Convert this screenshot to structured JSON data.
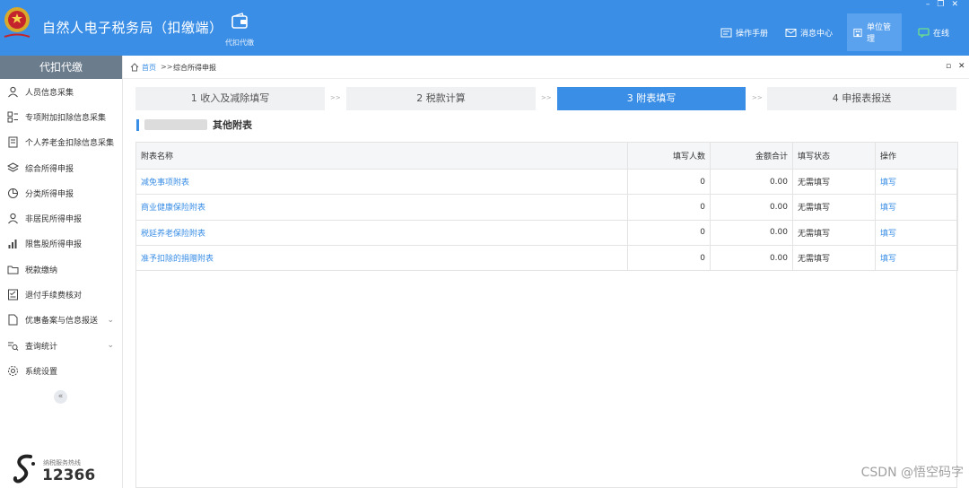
{
  "header": {
    "title": "自然人电子税务局（扣缴端）",
    "module_label": "代扣代缴",
    "menu": [
      {
        "label": "操作手册",
        "icon": "manual-icon"
      },
      {
        "label": "消息中心",
        "icon": "mail-icon"
      },
      {
        "label": "单位管理",
        "icon": "building-icon"
      },
      {
        "label": "在线",
        "icon": "chat-icon"
      }
    ],
    "window_controls": [
      "–",
      "❐",
      "✕"
    ]
  },
  "sidebar": {
    "title": "代扣代缴",
    "items": [
      {
        "label": "人员信息采集",
        "icon": "person-icon"
      },
      {
        "label": "专项附加扣除信息采集",
        "icon": "grid-icon"
      },
      {
        "label": "个人养老金扣除信息采集",
        "icon": "document-icon"
      },
      {
        "label": "综合所得申报",
        "icon": "layers-icon"
      },
      {
        "label": "分类所得申报",
        "icon": "pie-icon"
      },
      {
        "label": "非居民所得申报",
        "icon": "person-icon"
      },
      {
        "label": "限售股所得申报",
        "icon": "bar-chart-icon"
      },
      {
        "label": "税款缴纳",
        "icon": "folder-icon"
      },
      {
        "label": "退付手续费核对",
        "icon": "checklist-icon"
      },
      {
        "label": "优惠备案与信息报送",
        "icon": "file-icon",
        "expandable": true
      },
      {
        "label": "查询统计",
        "icon": "search-list-icon",
        "expandable": true
      },
      {
        "label": "系统设置",
        "icon": "gear-icon"
      }
    ],
    "collapse_glyph": "«",
    "hotline_label": "纳税服务热线",
    "hotline_number": "12366"
  },
  "breadcrumb": {
    "home": "首页",
    "separator": ">>",
    "current": "综合所得申报"
  },
  "steps": [
    {
      "label": "1 收入及减除填写",
      "active": false
    },
    {
      "label": "2 税款计算",
      "active": false
    },
    {
      "label": "3 附表填写",
      "active": true
    },
    {
      "label": "4 申报表报送",
      "active": false
    }
  ],
  "step_separator": ">>",
  "section": {
    "title": "其他附表"
  },
  "table": {
    "columns": [
      "附表名称",
      "填写人数",
      "金额合计",
      "填写状态",
      "操作"
    ],
    "rows": [
      {
        "name": "减免事项附表",
        "count": "0",
        "amount": "0.00",
        "status": "无需填写",
        "action": "填写"
      },
      {
        "name": "商业健康保险附表",
        "count": "0",
        "amount": "0.00",
        "status": "无需填写",
        "action": "填写"
      },
      {
        "name": "税延养老保险附表",
        "count": "0",
        "amount": "0.00",
        "status": "无需填写",
        "action": "填写"
      },
      {
        "name": "准予扣除的捐赠附表",
        "count": "0",
        "amount": "0.00",
        "status": "无需填写",
        "action": "填写"
      }
    ]
  },
  "watermark": "CSDN @悟空码字",
  "colors": {
    "primary": "#3a8ee6",
    "sidebar_title_bg": "#6b7c8d",
    "link": "#3a8ee6"
  }
}
